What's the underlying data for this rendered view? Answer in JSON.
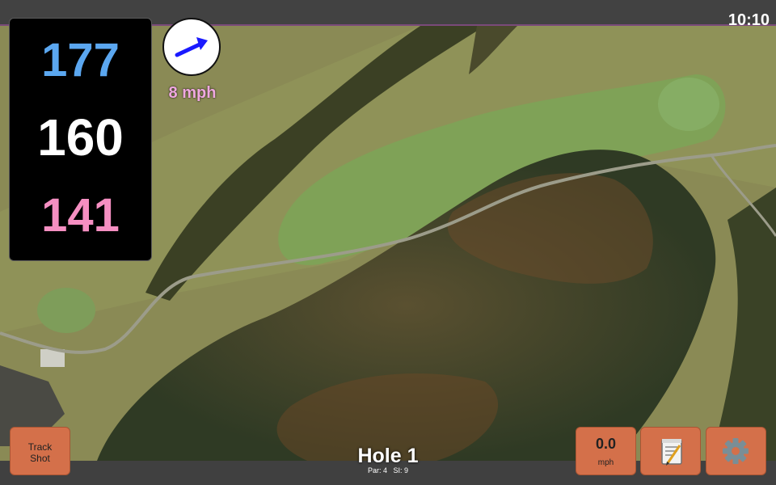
{
  "status": {
    "time": "10:10"
  },
  "distances": {
    "back": "177",
    "center": "160",
    "front": "141"
  },
  "wind": {
    "speed_label": "8 mph",
    "direction_icon": "arrow-up-right-icon"
  },
  "controls": {
    "track_shot": {
      "line1": "Track",
      "line2": "Shot"
    },
    "wind_button": {
      "value": "0.0",
      "unit": "mph"
    },
    "notes_icon": "notepad-icon",
    "settings_icon": "gear-icon"
  },
  "hole": {
    "title": "Hole 1",
    "par_label": "Par: 4",
    "si_label": "SI: 9"
  },
  "colors": {
    "accent": "#d4704a",
    "back_distance": "#5ba7f0",
    "front_distance": "#f58fc2",
    "wind_arrow": "#1a1aff"
  }
}
